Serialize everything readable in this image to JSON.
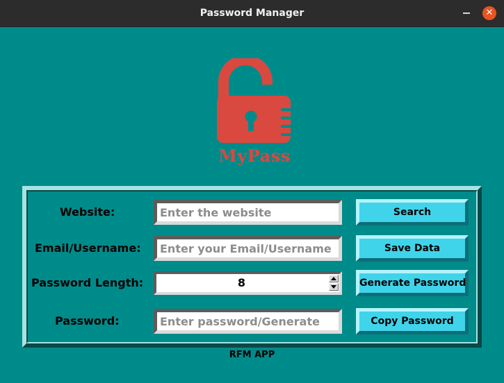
{
  "window": {
    "title": "Password Manager",
    "minimize_icon": "minimize-icon",
    "close_icon": "close-icon",
    "close_glyph": "✕"
  },
  "logo": {
    "icon": "padlock-icon",
    "text": "MyPass",
    "color": "#d9493f"
  },
  "form": {
    "website": {
      "label": "Website:",
      "placeholder": "Enter the website",
      "value": ""
    },
    "email": {
      "label": "Email/Username:",
      "placeholder": "Enter your Email/Username",
      "value": ""
    },
    "length": {
      "label": "Password Length:",
      "value": "8"
    },
    "password": {
      "label": "Password:",
      "placeholder": "Enter password/Generate",
      "value": ""
    }
  },
  "buttons": {
    "search": "Search",
    "save": "Save Data",
    "generate": "Generate Password",
    "copy": "Copy Password"
  },
  "footer": "RFM APP",
  "colors": {
    "background": "#008b8b",
    "titlebar": "#2c2c2c",
    "button": "#3fd4ea",
    "close": "#e95420"
  }
}
